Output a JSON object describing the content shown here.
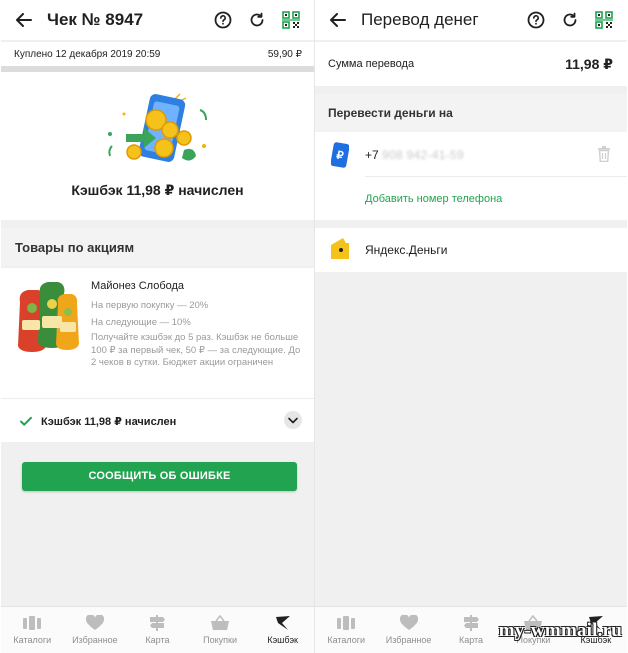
{
  "left_screen": {
    "title": "Чек № 8947",
    "purchase_date": "Куплено 12 декабря 2019 20:59",
    "purchase_amount": "59,90 ₽",
    "cashback_message": "Кэшбэк 11,98 ₽ начислен",
    "promo_section_title": "Товары по акциям",
    "product": {
      "name": "Майонез Слобода",
      "first_purchase": "На первую покупку — 20%",
      "next_purchases": "На следующие — 10%",
      "description": "Получайте кэшбэк до 5 раз. Кэшбэк не больше 100 ₽ за первый чек, 50 ₽ — за следующие. До 2 чеков в сутки. Бюджет акции ограничен"
    },
    "status_label": "Кэшбэк 11,98 ₽ начислен",
    "report_button": "СООБЩИТЬ ОБ ОШИБКЕ"
  },
  "right_screen": {
    "title": "Перевод денег",
    "sum_label": "Сумма перевода",
    "sum_value": "11,98 ₽",
    "transfer_to_title": "Перевести деньги на",
    "phone_prefix": "+7",
    "phone_masked": "908 942-41-59",
    "add_phone_link": "Добавить номер телефона",
    "wallet_name": "Яндекс.Деньги"
  },
  "nav_items": [
    {
      "label": "Каталоги",
      "icon": "catalog-icon"
    },
    {
      "label": "Избранное",
      "icon": "heart-icon"
    },
    {
      "label": "Карта",
      "icon": "signpost-icon"
    },
    {
      "label": "Покупки",
      "icon": "basket-icon"
    },
    {
      "label": "Кэшбэк",
      "icon": "cashback-icon"
    }
  ],
  "nav_active": "Кэшбэк",
  "watermark": "my-wmmail.ru",
  "colors": {
    "accent_green": "#22a350",
    "text": "#212121",
    "muted": "#9a9a9a",
    "background": "#f0f0f0"
  }
}
